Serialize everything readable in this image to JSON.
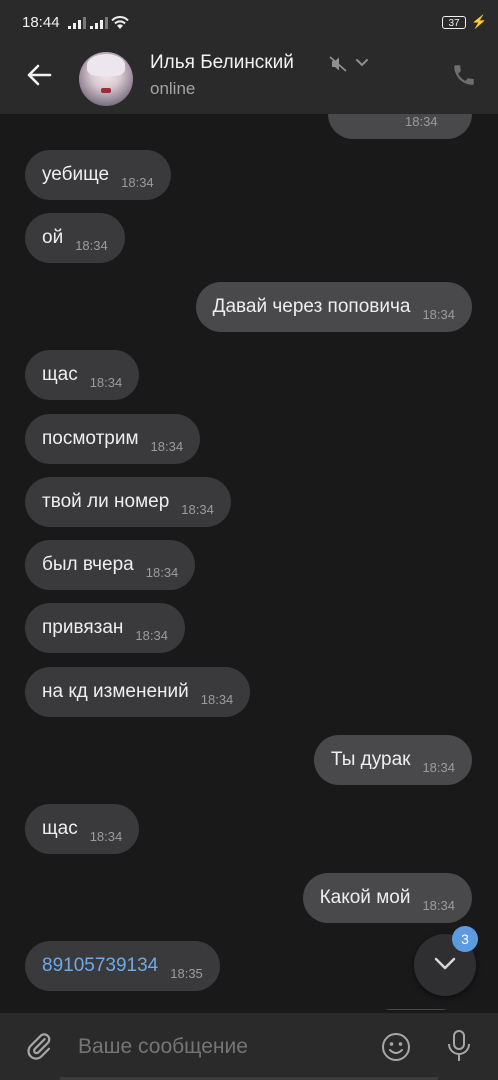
{
  "status_bar": {
    "time": "18:44",
    "battery": "37"
  },
  "header": {
    "contact_name": "Илья Белинский",
    "contact_status": "online"
  },
  "messages": [
    {
      "dir": "out",
      "text": "",
      "time": "18:34"
    },
    {
      "dir": "in",
      "text": "уебище",
      "time": "18:34"
    },
    {
      "dir": "in",
      "text": "ой",
      "time": "18:34"
    },
    {
      "dir": "out",
      "text": "Давай через поповича",
      "time": "18:34"
    },
    {
      "dir": "in",
      "text": "щас",
      "time": "18:34"
    },
    {
      "dir": "in",
      "text": "посмотрим",
      "time": "18:34"
    },
    {
      "dir": "in",
      "text": "твой ли номер",
      "time": "18:34"
    },
    {
      "dir": "in",
      "text": "был вчера",
      "time": "18:34"
    },
    {
      "dir": "in",
      "text": "привязан",
      "time": "18:34"
    },
    {
      "dir": "in",
      "text": "на кд изменений",
      "time": "18:34"
    },
    {
      "dir": "out",
      "text": "Ты дурак",
      "time": "18:34"
    },
    {
      "dir": "in",
      "text": "щас",
      "time": "18:34"
    },
    {
      "dir": "out",
      "text": "Какой мой",
      "time": "18:34"
    },
    {
      "dir": "in",
      "text": "89105739134",
      "time": "18:35",
      "link": true
    }
  ],
  "scroll_down": {
    "unread_count": "3"
  },
  "input": {
    "placeholder": "Ваше сообщение"
  },
  "colors": {
    "background": "#19191a",
    "bar": "#2a2a2b",
    "bubble_in": "#3a3a3c",
    "bubble_out": "#49494b",
    "link": "#6fa9e6",
    "badge": "#5d9be0"
  },
  "icons": [
    "back-arrow-icon",
    "mute-icon",
    "chevron-down-icon",
    "phone-icon",
    "paperclip-icon",
    "emoji-icon",
    "microphone-icon"
  ]
}
